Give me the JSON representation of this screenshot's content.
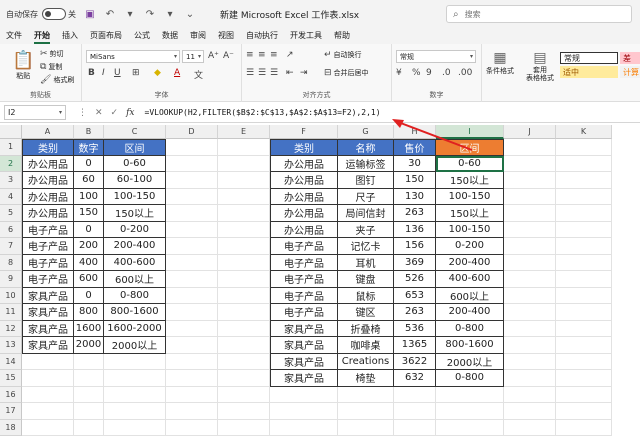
{
  "titlebar": {
    "autosave_label": "自动保存",
    "autosave_state": "关",
    "doc_title": "新建 Microsoft Excel 工作表.xlsx",
    "search_placeholder": "搜索"
  },
  "menu": [
    "文件",
    "开始",
    "插入",
    "页面布局",
    "公式",
    "数据",
    "审阅",
    "视图",
    "自动执行",
    "开发工具",
    "帮助"
  ],
  "active_menu": "开始",
  "ribbon": {
    "clipboard": {
      "paste": "粘贴",
      "cut": "剪切",
      "copy": "复制",
      "format_painter": "格式刷",
      "label": "剪贴板"
    },
    "font": {
      "name": "MiSans",
      "size": "11",
      "label": "字体"
    },
    "alignment": {
      "wrap": "自动换行",
      "merge": "合并后居中",
      "label": "对齐方式"
    },
    "number": {
      "format": "常规",
      "label": "数字"
    },
    "styles": {
      "conditional": "条件格式",
      "table": "套用\n表格格式",
      "normal": "常规",
      "bad": "差",
      "neutral": "适中",
      "calc": "计算"
    }
  },
  "formula_bar": {
    "name_box": "I2",
    "fx": "fx",
    "formula": "=VLOOKUP(H2,FILTER($B$2:$C$13,$A$2:$A$13=F2),2,1)"
  },
  "columns": [
    "A",
    "B",
    "C",
    "D",
    "E",
    "F",
    "G",
    "H",
    "I",
    "J",
    "K"
  ],
  "rows": [
    "1",
    "2",
    "3",
    "4",
    "5",
    "6",
    "7",
    "8",
    "9",
    "10",
    "11",
    "12",
    "13",
    "14",
    "15",
    "16",
    "17",
    "18"
  ],
  "left_table": {
    "headers": [
      "类别",
      "数字",
      "区间"
    ],
    "rows": [
      [
        "办公用品",
        "0",
        "0-60"
      ],
      [
        "办公用品",
        "60",
        "60-100"
      ],
      [
        "办公用品",
        "100",
        "100-150"
      ],
      [
        "办公用品",
        "150",
        "150以上"
      ],
      [
        "电子产品",
        "0",
        "0-200"
      ],
      [
        "电子产品",
        "200",
        "200-400"
      ],
      [
        "电子产品",
        "400",
        "400-600"
      ],
      [
        "电子产品",
        "600",
        "600以上"
      ],
      [
        "家具产品",
        "0",
        "0-800"
      ],
      [
        "家具产品",
        "800",
        "800-1600"
      ],
      [
        "家具产品",
        "1600",
        "1600-2000"
      ],
      [
        "家具产品",
        "2000",
        "2000以上"
      ]
    ]
  },
  "right_table": {
    "headers": [
      "类别",
      "名称",
      "售价",
      "区间"
    ],
    "rows": [
      [
        "办公用品",
        "运输标签",
        "30",
        "0-60"
      ],
      [
        "办公用品",
        "图钉",
        "150",
        "150以上"
      ],
      [
        "办公用品",
        "尺子",
        "130",
        "100-150"
      ],
      [
        "办公用品",
        "局间信封",
        "263",
        "150以上"
      ],
      [
        "办公用品",
        "夹子",
        "136",
        "100-150"
      ],
      [
        "电子产品",
        "记忆卡",
        "156",
        "0-200"
      ],
      [
        "电子产品",
        "耳机",
        "369",
        "200-400"
      ],
      [
        "电子产品",
        "键盘",
        "526",
        "400-600"
      ],
      [
        "电子产品",
        "鼠标",
        "653",
        "600以上"
      ],
      [
        "电子产品",
        "键区",
        "263",
        "200-400"
      ],
      [
        "家具产品",
        "折叠椅",
        "536",
        "0-800"
      ],
      [
        "家具产品",
        "咖啡桌",
        "1365",
        "800-1600"
      ],
      [
        "家具产品",
        "Creations",
        "3622",
        "2000以上"
      ],
      [
        "家具产品",
        "椅垫",
        "632",
        "0-800"
      ]
    ]
  },
  "colors": {
    "header_blue": "#4472c4",
    "header_orange": "#ed7d31",
    "accent_green": "#1e7145",
    "annotation_red": "#e02020"
  }
}
